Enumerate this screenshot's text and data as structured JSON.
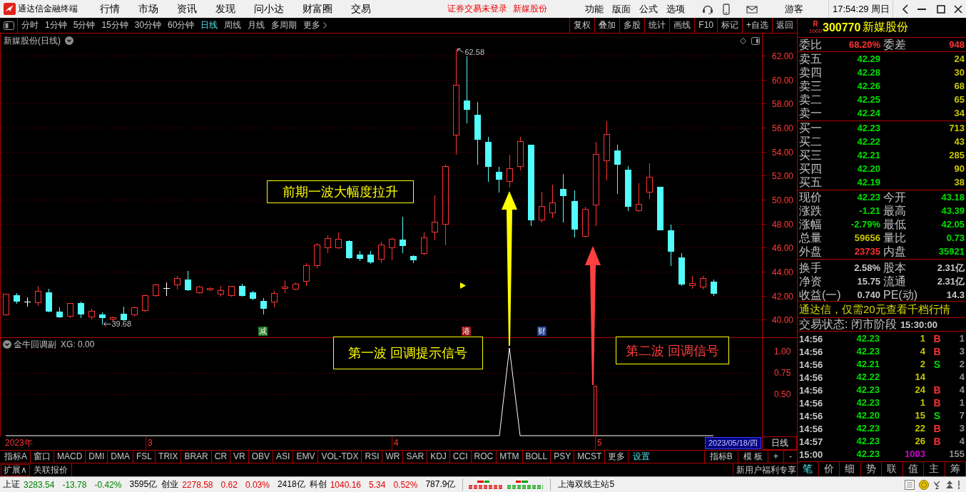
{
  "title_bar": {
    "app_name": "通达信金融终端",
    "menus": [
      "行情",
      "市场",
      "资讯",
      "发现",
      "问小达",
      "财富圈",
      "交易"
    ],
    "login_status": "证券交易未登录",
    "stock_name": "新媒股份",
    "tools": [
      "功能",
      "版面",
      "公式",
      "选项"
    ],
    "user": "游客",
    "clock": "17:54:29 周日"
  },
  "toolbar": {
    "periods": [
      {
        "label": "分时",
        "selected": false
      },
      {
        "label": "1分钟",
        "selected": false
      },
      {
        "label": "5分钟",
        "selected": false
      },
      {
        "label": "15分钟",
        "selected": false
      },
      {
        "label": "30分钟",
        "selected": false
      },
      {
        "label": "60分钟",
        "selected": false
      },
      {
        "label": "日线",
        "selected": true
      },
      {
        "label": "周线",
        "selected": false
      },
      {
        "label": "月线",
        "selected": false
      },
      {
        "label": "多周期",
        "selected": false
      }
    ],
    "more": "更多",
    "actions": [
      "复权",
      "叠加",
      "多股",
      "统计",
      "画线",
      "F10",
      "标记",
      "+自选",
      "返回"
    ]
  },
  "chart": {
    "title": "新媒股份(日线)",
    "chart_data": {
      "type": "candlestick",
      "grid": true,
      "categories": [
        null,
        null,
        null,
        null,
        null,
        null,
        null,
        null,
        null,
        null,
        null,
        null,
        null,
        null,
        null,
        null,
        null,
        null,
        null,
        null,
        null,
        null,
        null,
        null,
        null,
        null,
        null,
        null,
        null,
        null,
        null,
        null,
        null,
        null,
        null,
        null,
        null,
        null,
        null,
        null,
        null,
        null,
        null,
        null,
        null,
        null,
        null,
        null,
        null,
        null,
        null,
        null,
        null,
        null,
        null,
        null,
        null,
        null,
        null,
        null,
        null,
        null,
        null,
        null,
        null,
        null,
        null,
        null,
        null,
        null,
        null
      ],
      "ohlc": [
        [
          40.43,
          42.21,
          40.38,
          42.13
        ],
        [
          42.04,
          42.26,
          41.36,
          41.53
        ],
        [
          41.49,
          41.91,
          41.15,
          41.49
        ],
        [
          41.45,
          42.85,
          41.19,
          42.38
        ],
        [
          42.3,
          42.6,
          40.64,
          40.72
        ],
        [
          40.64,
          41.06,
          40.17,
          40.26
        ],
        [
          40.3,
          41.45,
          40.21,
          41.36
        ],
        [
          41.36,
          41.57,
          40.21,
          40.47
        ],
        [
          40.26,
          40.94,
          40.09,
          40.72
        ],
        [
          40.43,
          40.68,
          39.68,
          40.17
        ],
        [
          40.09,
          40.34,
          39.87,
          40.21
        ],
        [
          40.51,
          41.15,
          39.96,
          40.0
        ],
        [
          40.43,
          41.15,
          40.34,
          41.02
        ],
        [
          40.77,
          42.13,
          40.68,
          42.04
        ],
        [
          42.04,
          43.06,
          41.96,
          42.94
        ],
        [
          42.6,
          43.15,
          42.04,
          42.6
        ],
        [
          42.94,
          43.7,
          42.55,
          43.49
        ],
        [
          43.36,
          44.13,
          42.43,
          42.51
        ],
        [
          42.26,
          42.85,
          42.21,
          42.77
        ],
        [
          42.51,
          42.72,
          42.43,
          42.64
        ],
        [
          42.13,
          42.85,
          42.0,
          42.47
        ],
        [
          42.04,
          42.89,
          41.96,
          42.81
        ],
        [
          42.81,
          43.06,
          41.96,
          42.04
        ],
        [
          42.3,
          42.47,
          41.7,
          41.79
        ],
        [
          41.53,
          41.87,
          40.51,
          40.94
        ],
        [
          41.49,
          42.43,
          41.06,
          42.21
        ],
        [
          42.6,
          43.36,
          42.3,
          42.72
        ],
        [
          42.55,
          43.19,
          42.51,
          42.98
        ],
        [
          43.23,
          44.77,
          42.85,
          44.51
        ],
        [
          44.55,
          46.43,
          44.34,
          46.26
        ],
        [
          46.04,
          47.11,
          45.62,
          46.77
        ],
        [
          46.04,
          47.32,
          45.96,
          46.72
        ],
        [
          46.55,
          46.64,
          45.11,
          45.19
        ],
        [
          45.45,
          45.79,
          44.94,
          45.11
        ],
        [
          45.45,
          45.79,
          44.68,
          44.85
        ],
        [
          45.06,
          46.55,
          44.77,
          46.26
        ],
        [
          46.04,
          46.89,
          44.98,
          46.72
        ],
        [
          46.64,
          48.6,
          45.62,
          46.17
        ],
        [
          45.32,
          45.45,
          44.77,
          45.02
        ],
        [
          45.53,
          47.32,
          45.4,
          46.85
        ],
        [
          47.32,
          50.43,
          46.68,
          48.13
        ],
        [
          47.96,
          52.98,
          46.26,
          52.77
        ],
        [
          55.4,
          62.58,
          53.79,
          59.57
        ],
        [
          58.26,
          62.0,
          56.43,
          57.53
        ],
        [
          57.06,
          58.17,
          52.94,
          55.06
        ],
        [
          54.81,
          55.28,
          51.57,
          52.77
        ],
        [
          52.34,
          52.77,
          50.64,
          51.74
        ],
        [
          51.57,
          53.79,
          51.06,
          52.64
        ],
        [
          52.77,
          55.28,
          52.51,
          54.89
        ],
        [
          54.55,
          54.55,
          47.87,
          48.34
        ],
        [
          48.34,
          50.72,
          48.17,
          49.49
        ],
        [
          48.94,
          51.32,
          48.51,
          49.74
        ],
        [
          50.89,
          52.21,
          48.17,
          50.38
        ],
        [
          49.87,
          50.81,
          46.89,
          47.57
        ],
        [
          46.98,
          49.45,
          46.89,
          49.23
        ],
        [
          49.57,
          54.89,
          47.87,
          53.79
        ],
        [
          53.28,
          56.6,
          51.66,
          55.45
        ],
        [
          54.09,
          54.64,
          50.51,
          52.94
        ],
        [
          52.51,
          52.85,
          49.11,
          49.45
        ],
        [
          49.11,
          51.4,
          49.02,
          49.66
        ],
        [
          50.64,
          53.06,
          50.09,
          51.91
        ],
        [
          51.06,
          51.06,
          47.53,
          47.53
        ],
        [
          47.45,
          47.96,
          44.55,
          45.7
        ],
        [
          45.19,
          45.62,
          42.85,
          42.98
        ],
        [
          42.89,
          43.7,
          42.64,
          43.06
        ],
        [
          42.77,
          43.7,
          42.55,
          43.44
        ],
        [
          43.18,
          43.39,
          42.05,
          42.23
        ],
        null,
        null,
        null,
        null
      ],
      "ylim": [
        30.27,
        63.84
      ],
      "yticks": [
        {
          "value": 62,
          "label": "62.00"
        },
        {
          "value": 60,
          "label": "60.00"
        },
        {
          "value": 58,
          "label": "58.00"
        },
        {
          "value": 56,
          "label": "56.00"
        },
        {
          "value": 54,
          "label": "54.00"
        },
        {
          "value": 52,
          "label": "52.00"
        },
        {
          "value": 50,
          "label": "50.00"
        },
        {
          "value": 48,
          "label": "48.00"
        },
        {
          "value": 46,
          "label": "46.00"
        },
        {
          "value": 44,
          "label": "44.00"
        },
        {
          "value": 42,
          "label": "42.00"
        },
        {
          "value": 40,
          "label": "40.00"
        }
      ]
    },
    "high_label": "62.58",
    "low_label": "39.68",
    "event_tags": [
      {
        "label": "减",
        "color": "#1f7a1f"
      },
      {
        "label": "港",
        "color": "#9a1414"
      },
      {
        "label": "财",
        "color": "#1c3a8c"
      }
    ],
    "annotations": [
      {
        "text": "前期一波大幅度拉升",
        "color": "#ffff00"
      },
      {
        "text": "第一波 回调提示信号",
        "color": "#ffff00"
      },
      {
        "text": "第二波 回调信号",
        "color": "#ff3c3c"
      }
    ]
  },
  "indicator": {
    "name": "金牛回调副",
    "value": "XG: 0.00",
    "ticks": [
      "1.00",
      "0.75",
      "0.50"
    ]
  },
  "date_axis": {
    "year": "2023年",
    "months": [
      "3",
      "4",
      "5"
    ],
    "cursor_date": "2023/05/18/四",
    "period": "日线"
  },
  "indicator_bar": {
    "tabs": [
      "指标A",
      "窗口",
      "MACD",
      "DMI",
      "DMA",
      "FSL",
      "TRIX",
      "BRAR",
      "CR",
      "VR",
      "OBV",
      "ASI",
      "EMV",
      "VOL-TDX",
      "RSI",
      "WR",
      "SAR",
      "KDJ",
      "CCI",
      "ROC",
      "MTM",
      "BOLL",
      "PSY",
      "MCST",
      "更多"
    ],
    "settings": "设置",
    "right": [
      "指标B",
      "模 板",
      "+",
      "-"
    ]
  },
  "extension_bar": {
    "expand": "扩展∧",
    "linked_quotes": "关联报价",
    "promo": "新用户福利专享"
  },
  "quote": {
    "badge": "R",
    "badge_sub": "1000",
    "code": "300770",
    "name": "新媒股份",
    "ratio": [
      {
        "label": "委比",
        "value": "68.20%",
        "color": "#ff3232"
      },
      {
        "label": "委差",
        "value": "948",
        "color": "#ff3232"
      }
    ],
    "asks": [
      {
        "label": "卖五",
        "price": "42.29",
        "volume": "24"
      },
      {
        "label": "卖四",
        "price": "42.28",
        "volume": "30"
      },
      {
        "label": "卖三",
        "price": "42.26",
        "volume": "68"
      },
      {
        "label": "卖二",
        "price": "42.25",
        "volume": "65"
      },
      {
        "label": "卖一",
        "price": "42.24",
        "volume": "34"
      }
    ],
    "bids": [
      {
        "label": "买一",
        "price": "42.23",
        "volume": "713"
      },
      {
        "label": "买二",
        "price": "42.22",
        "volume": "43"
      },
      {
        "label": "买三",
        "price": "42.21",
        "volume": "285"
      },
      {
        "label": "买四",
        "price": "42.20",
        "volume": "90"
      },
      {
        "label": "买五",
        "price": "42.19",
        "volume": "38"
      }
    ],
    "stats": [
      {
        "label": "现价",
        "value": "42.23",
        "color": "#00e000"
      },
      {
        "label": "今开",
        "value": "43.18",
        "color": "#00e000"
      },
      {
        "label": "涨跌",
        "value": "-1.21",
        "color": "#00e000"
      },
      {
        "label": "最高",
        "value": "43.39",
        "color": "#00e000"
      },
      {
        "label": "涨幅",
        "value": "-2.79%",
        "color": "#00e000"
      },
      {
        "label": "最低",
        "value": "42.05",
        "color": "#00e000"
      },
      {
        "label": "总量",
        "value": "59656",
        "color": "#c8c800"
      },
      {
        "label": "量比",
        "value": "0.73",
        "color": "#00e000"
      },
      {
        "label": "外盘",
        "value": "23735",
        "color": "#ff3232"
      },
      {
        "label": "内盘",
        "value": "35921",
        "color": "#00e000"
      }
    ],
    "fundamentals": [
      {
        "label": "换手",
        "value": "2.58%"
      },
      {
        "label": "股本",
        "value": "2.31亿"
      },
      {
        "label": "净资",
        "value": "15.75"
      },
      {
        "label": "流通",
        "value": "2.31亿"
      },
      {
        "label": "收益(一)",
        "value": "0.740"
      },
      {
        "label": "PE(动)",
        "value": "14.3"
      }
    ],
    "promo": "通达信，仅需20元查看千档行情",
    "status": "交易状态: 闭市阶段",
    "status_time": "15:30:00",
    "ticks": [
      {
        "time": "14:56",
        "price": "42.23",
        "volume": "1",
        "side": "B",
        "count": "1",
        "kind": "buy"
      },
      {
        "time": "14:56",
        "price": "42.23",
        "volume": "4",
        "side": "B",
        "count": "3",
        "kind": "buy"
      },
      {
        "time": "14:56",
        "price": "42.21",
        "volume": "2",
        "side": "S",
        "count": "2",
        "kind": "sell"
      },
      {
        "time": "14:56",
        "price": "42.22",
        "volume": "14",
        "count": "4",
        "kind": "neutral"
      },
      {
        "time": "14:56",
        "price": "42.23",
        "volume": "24",
        "side": "B",
        "count": "4",
        "kind": "buy"
      },
      {
        "time": "14:56",
        "price": "42.23",
        "volume": "1",
        "side": "B",
        "count": "1",
        "kind": "buy"
      },
      {
        "time": "14:56",
        "price": "42.20",
        "volume": "15",
        "side": "S",
        "count": "7",
        "kind": "sell"
      },
      {
        "time": "14:56",
        "price": "42.23",
        "volume": "22",
        "side": "B",
        "count": "3",
        "kind": "buy"
      },
      {
        "time": "14:57",
        "price": "42.23",
        "volume": "26",
        "side": "B",
        "count": "4",
        "kind": "buy"
      },
      {
        "time": "15:00",
        "price": "42.23",
        "volume": "1003",
        "count": "155",
        "kind": "closing"
      }
    ],
    "tabs": [
      {
        "label": "笔",
        "selected": true
      },
      {
        "label": "价",
        "selected": false
      },
      {
        "label": "细",
        "selected": false
      },
      {
        "label": "势",
        "selected": false
      },
      {
        "label": "联",
        "selected": false
      },
      {
        "label": "值",
        "selected": false
      },
      {
        "label": "主",
        "selected": false
      },
      {
        "label": "筹",
        "selected": false
      }
    ]
  },
  "status_bar": {
    "indices": [
      {
        "name": "上证",
        "price": "3283.54",
        "change": "-13.78",
        "percent": "-0.42%",
        "turnover": "3595亿",
        "kind": "down"
      },
      {
        "name": "创业",
        "price": "2278.58",
        "change": "0.62",
        "percent": "0.03%",
        "turnover": "2418亿",
        "kind": "up"
      },
      {
        "name": "科创",
        "price": "1040.16",
        "change": "5.34",
        "percent": "0.52%",
        "turnover": "787.9亿",
        "kind": "up"
      }
    ],
    "server": "上海双线主站5"
  }
}
